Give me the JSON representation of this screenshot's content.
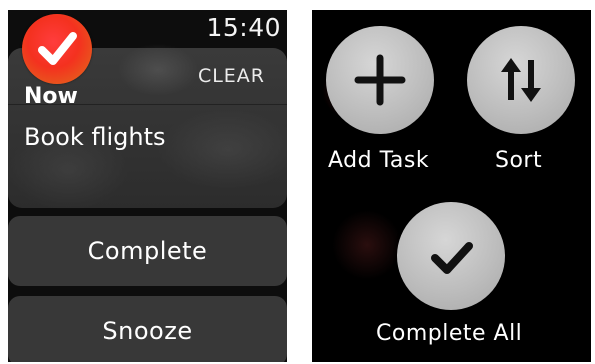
{
  "notification_screen": {
    "time": "15:40",
    "app_icon": "clear-checkmark-icon",
    "clear_label": "CLEAR",
    "heading": "Now",
    "body": "Book flights",
    "actions": [
      {
        "label": "Complete"
      },
      {
        "label": "Snooze"
      }
    ]
  },
  "menu_screen": {
    "items": [
      {
        "label": "Add Task",
        "icon": "plus-icon"
      },
      {
        "label": "Sort",
        "icon": "sort-arrows-icon"
      },
      {
        "label": "Complete All",
        "icon": "checkmark-icon"
      }
    ]
  },
  "colors": {
    "app_icon_red": "#f4311f",
    "app_icon_orange": "#f79b1f",
    "button_gray": "#3c3c3c",
    "circle_gray": "#bdbdbd"
  }
}
